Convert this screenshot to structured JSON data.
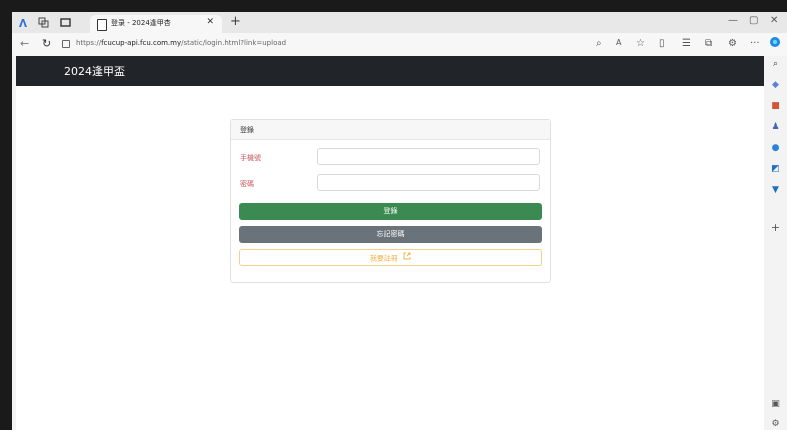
{
  "browser": {
    "tab_title": "登录 - 2024逢甲杏",
    "url_prefix": "https://",
    "url_host": "fcucup-api.fcu.com.my",
    "url_path": "/static/login.html?link=upload",
    "icons": [
      "edge-icon",
      "workspaces-icon",
      "tab-actions-icon",
      "page-icon",
      "close-icon",
      "plus-icon",
      "back-icon",
      "refresh-icon",
      "lock-icon",
      "reading-icon",
      "read-aloud-icon",
      "favorite-icon",
      "split-icon",
      "favorites-icon",
      "collections-icon",
      "extensions-icon",
      "more-icon",
      "copilot-icon"
    ]
  },
  "sidebar": {
    "icons": [
      "search-icon",
      "tag-icon",
      "shopping-icon",
      "people-icon",
      "circle-icon",
      "outlook-icon",
      "cart-icon",
      "add-icon",
      "screen-icon",
      "settings-icon"
    ]
  },
  "page": {
    "brand": "2024逢甲盃",
    "card_title": "登錄",
    "phone_label": "手機號",
    "password_label": "密碼",
    "phone_value": "",
    "password_value": "",
    "login_button": "登錄",
    "forgot_button": "忘記密碼",
    "register_button": "我要註冊"
  },
  "colors": {
    "navbar": "#212529",
    "login": "#3a8a52",
    "forgot": "#6b737a",
    "register_text": "#f0b44a",
    "label": "#c7575b"
  }
}
